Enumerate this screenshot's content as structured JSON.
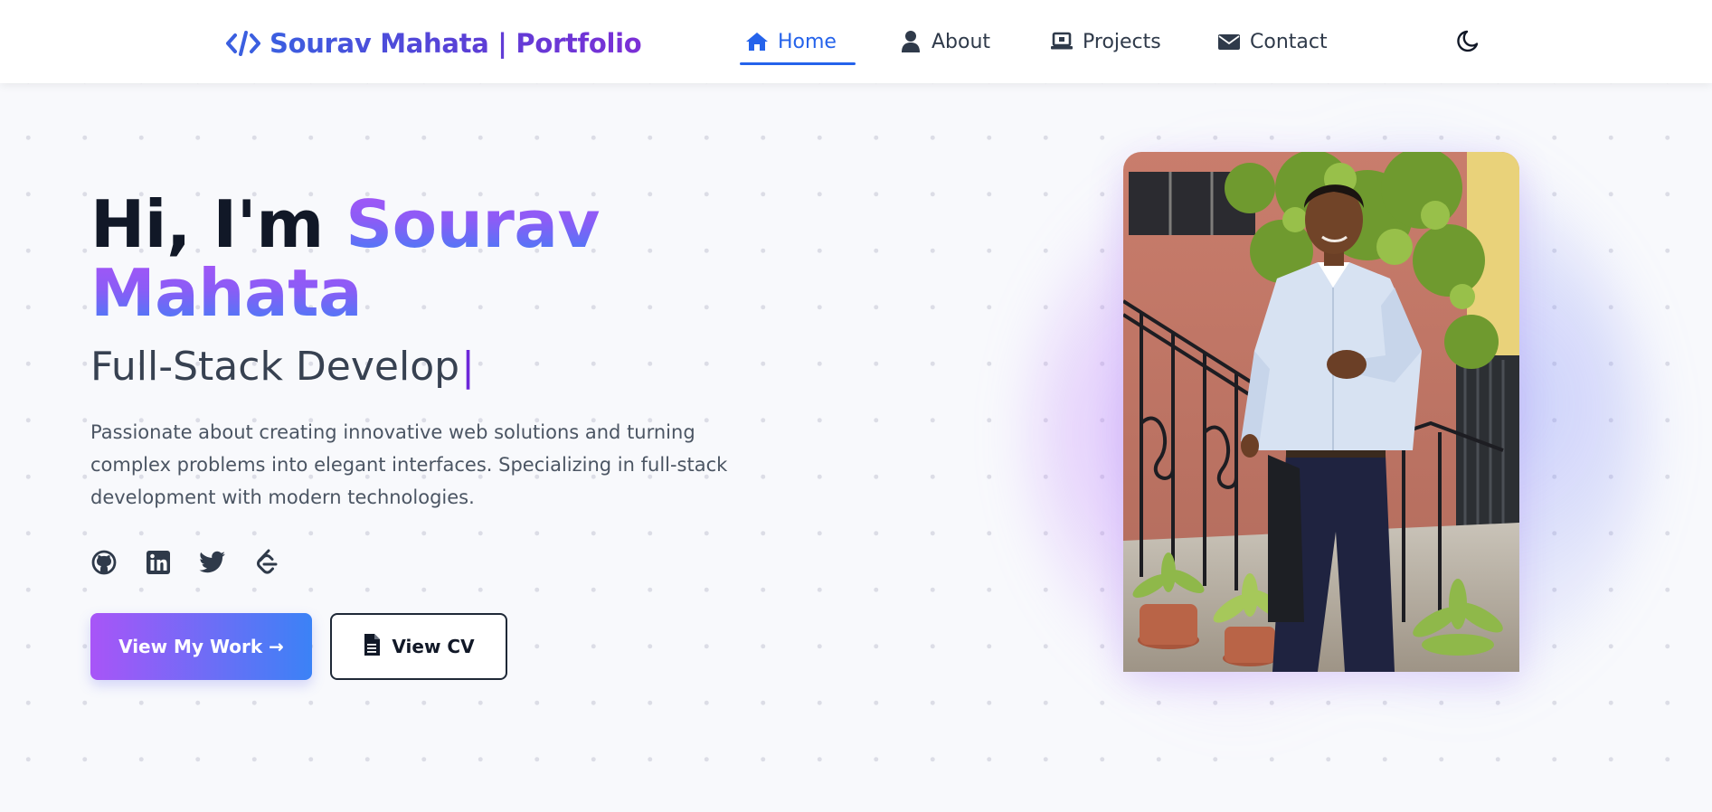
{
  "nav": {
    "brand": "Sourav Mahata | Portfolio",
    "links": [
      {
        "label": "Home",
        "icon": "home-icon",
        "active": true
      },
      {
        "label": "About",
        "icon": "user-icon",
        "active": false
      },
      {
        "label": "Projects",
        "icon": "laptop-icon",
        "active": false
      },
      {
        "label": "Contact",
        "icon": "envelope-icon",
        "active": false
      }
    ],
    "theme_icon": "moon-icon"
  },
  "hero": {
    "greeting": "Hi, I'm ",
    "name_first": "Sourav",
    "name_last": "Mahata",
    "role": "Full-Stack Develop",
    "cursor": "|",
    "description": "Passionate about creating innovative web solutions and turning complex problems into elegant interfaces. Specializing in full-stack development with modern technologies.",
    "socials": [
      "github-icon",
      "linkedin-icon",
      "twitter-icon",
      "leetcode-icon"
    ],
    "primary_button": "View My Work →",
    "secondary_button": "View CV",
    "secondary_icon": "document-icon"
  },
  "colors": {
    "accent_blue": "#2563eb",
    "gradient_purple": "#a855f7",
    "gradient_blue": "#3b82f6",
    "background": "#f8f9fc"
  }
}
